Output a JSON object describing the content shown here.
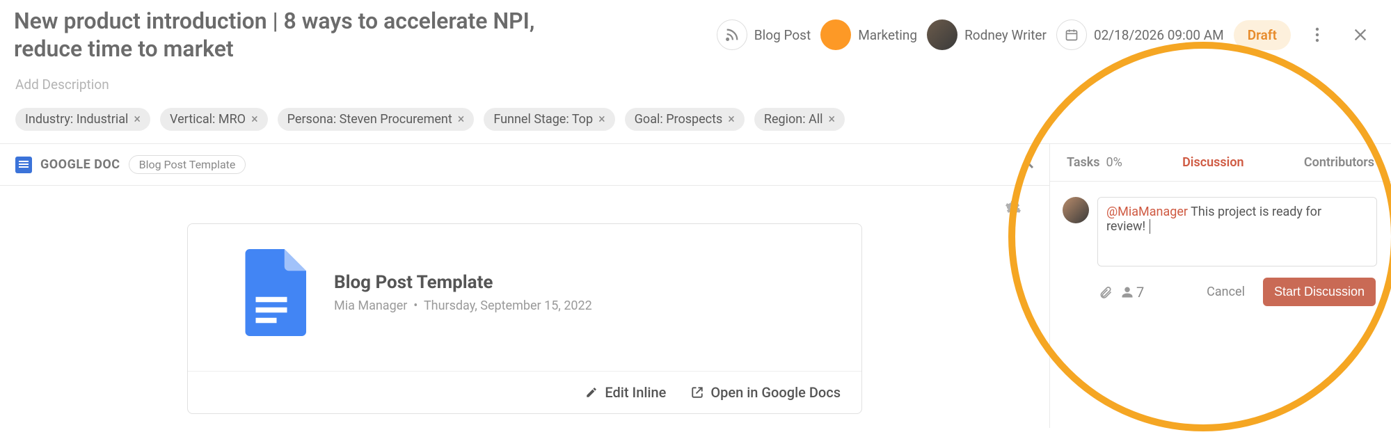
{
  "header": {
    "title": "New product introduction | 8 ways to accelerate NPI, reduce time to market",
    "add_description": "Add Description",
    "type_label": "Blog Post",
    "category_label": "Marketing",
    "author_label": "Rodney Writer",
    "date_label": "02/18/2026 09:00 AM",
    "status_label": "Draft"
  },
  "tags": [
    "Industry: Industrial",
    "Vertical: MRO",
    "Persona: Steven Procurement",
    "Funnel Stage: Top",
    "Goal: Prospects",
    "Region: All"
  ],
  "gdoc": {
    "section_label": "GOOGLE DOC",
    "template_chip": "Blog Post Template",
    "card_title": "Blog Post Template",
    "card_author": "Mia Manager",
    "card_date": "Thursday, September 15, 2022",
    "edit_inline_label": "Edit Inline",
    "open_docs_label": "Open in Google Docs"
  },
  "right_panel": {
    "tasks_label": "Tasks",
    "tasks_percent": "0%",
    "discussion_label": "Discussion",
    "contributors_label": "Contributors",
    "comment_mention": "@MiaManager",
    "comment_text": "This project is ready for review!",
    "attach_count": "7",
    "cancel_label": "Cancel",
    "start_label": "Start Discussion"
  }
}
